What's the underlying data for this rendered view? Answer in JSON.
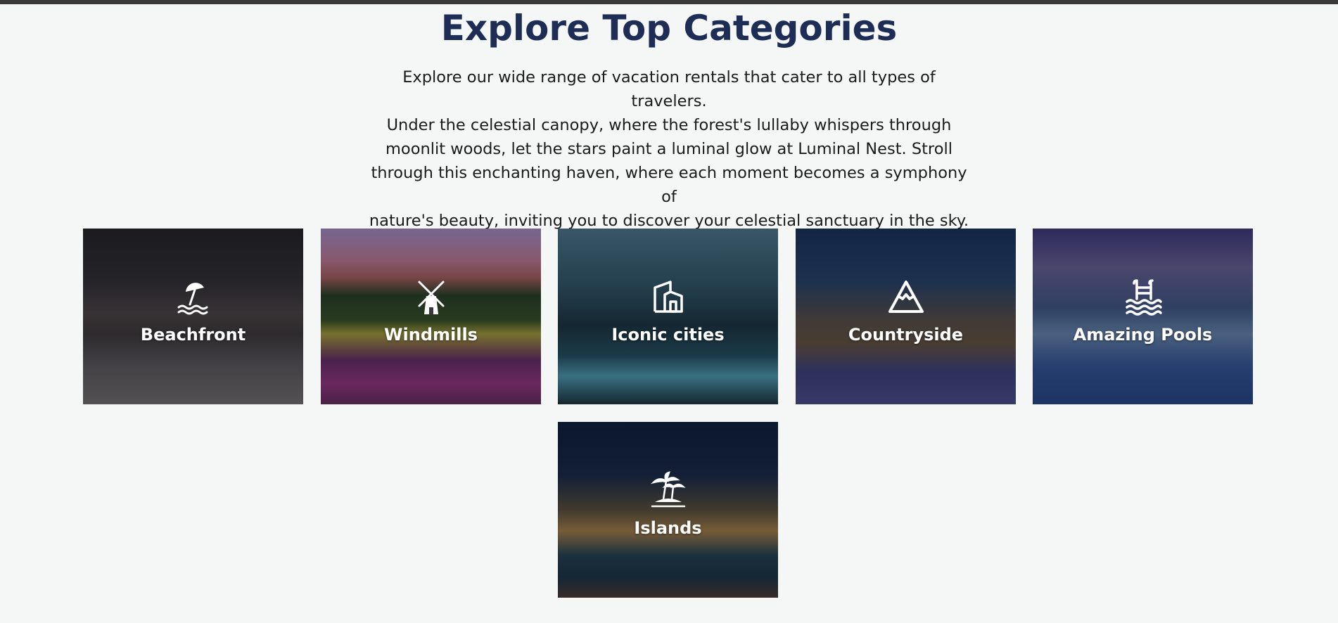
{
  "section": {
    "title": "Explore Top Categories",
    "description_lines": [
      "Explore our wide range of vacation rentals that cater to all types of travelers.",
      "Under the celestial canopy, where the forest's lullaby whispers through",
      "moonlit woods, let the stars paint a luminal glow at Luminal Nest. Stroll",
      "through this enchanting haven, where each moment becomes a symphony of",
      "nature's beauty, inviting you to discover your celestial sanctuary in the sky."
    ]
  },
  "categories": [
    {
      "label": "Beachfront",
      "icon": "beach-umbrella-icon"
    },
    {
      "label": "Windmills",
      "icon": "windmill-icon"
    },
    {
      "label": "Iconic cities",
      "icon": "city-building-icon"
    },
    {
      "label": "Countryside",
      "icon": "mountain-icon"
    },
    {
      "label": "Amazing Pools",
      "icon": "pool-ladder-icon"
    },
    {
      "label": "Islands",
      "icon": "palm-island-icon"
    }
  ],
  "colors": {
    "title": "#1e2d55",
    "background": "#f5f7f7",
    "label": "#ffffff"
  }
}
